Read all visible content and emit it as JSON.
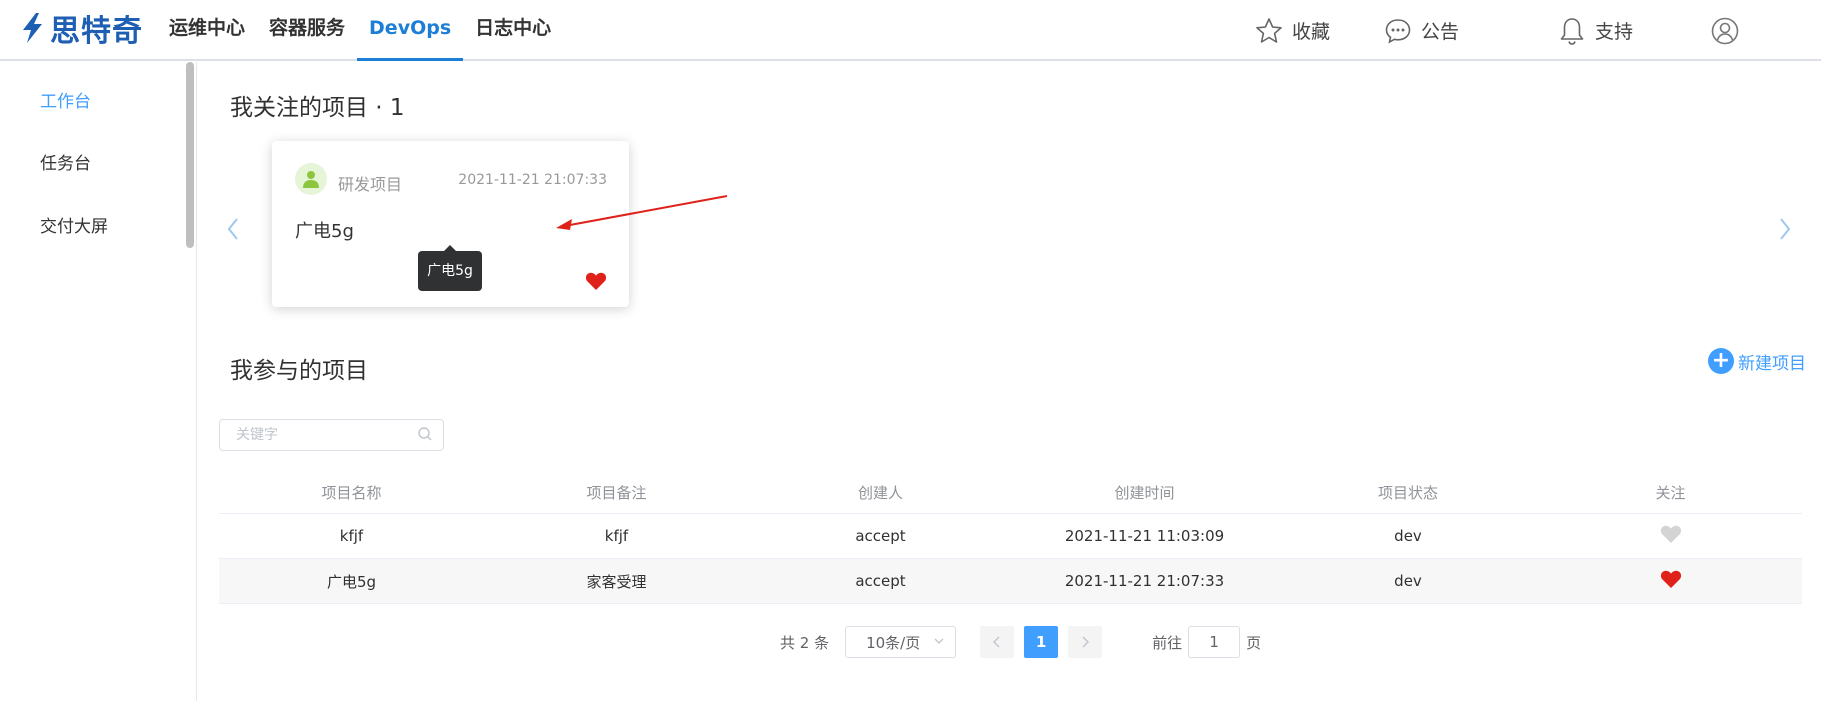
{
  "brand": {
    "name": "思特奇"
  },
  "nav": [
    {
      "label": "运维中心",
      "active": false
    },
    {
      "label": "容器服务",
      "active": false
    },
    {
      "label": "DevOps",
      "active": true
    },
    {
      "label": "日志中心",
      "active": false
    }
  ],
  "top_actions": {
    "favorites": "收藏",
    "announcements": "公告",
    "support": "支持"
  },
  "sidebar": {
    "items": [
      {
        "label": "工作台",
        "active": true
      },
      {
        "label": "任务台",
        "active": false
      },
      {
        "label": "交付大屏",
        "active": false
      }
    ]
  },
  "followed": {
    "title": "我关注的项目 · 1",
    "card": {
      "type": "研发项目",
      "time": "2021-11-21 21:07:33",
      "name": "广电5g",
      "favorited": true
    },
    "tooltip": "广电5g"
  },
  "participated": {
    "title": "我参与的项目",
    "new_button": "新建项目",
    "search_placeholder": "关键字",
    "columns": [
      "项目名称",
      "项目备注",
      "创建人",
      "创建时间",
      "项目状态",
      "关注"
    ],
    "rows": [
      {
        "name": "kfjf",
        "note": "kfjf",
        "creator": "accept",
        "time": "2021-11-21 11:03:09",
        "status": "dev",
        "followed": false
      },
      {
        "name": "广电5g",
        "note": "家客受理",
        "creator": "accept",
        "time": "2021-11-21 21:07:33",
        "status": "dev",
        "followed": true
      }
    ]
  },
  "pagination": {
    "total": "共 2 条",
    "page_size": "10条/页",
    "current": "1",
    "goto_label": "前往",
    "goto_value": "1",
    "page_suffix": "页"
  },
  "colors": {
    "accent": "#409eff",
    "nav_active": "#1c7ed6",
    "heart_on": "#e0211a",
    "heart_off": "#d4d4d4"
  }
}
